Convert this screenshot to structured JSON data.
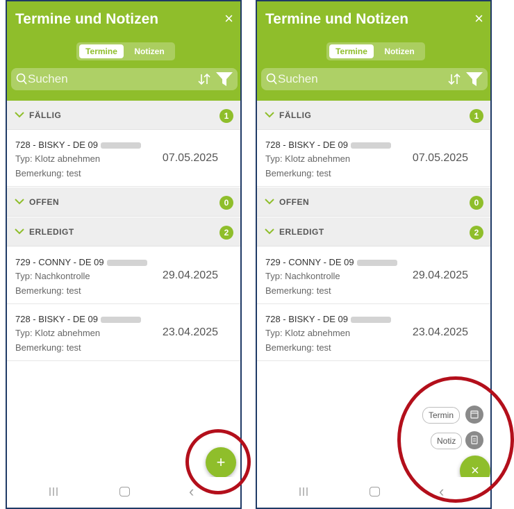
{
  "header": {
    "title": "Termine und Notizen",
    "close_symbol": "×",
    "tabs": [
      "Termine",
      "Notizen"
    ],
    "active_tab": "Termine",
    "search_placeholder": "Suchen"
  },
  "sections": [
    {
      "label": "FÄLLIG",
      "count": "1",
      "items": [
        {
          "title": "728 - BISKY - DE 09",
          "type": "Typ: Klotz abnehmen",
          "note": "Bemerkung: test",
          "date": "07.05.2025"
        }
      ]
    },
    {
      "label": "OFFEN",
      "count": "0",
      "items": []
    },
    {
      "label": "ERLEDIGT",
      "count": "2",
      "items": [
        {
          "title": "729 - CONNY - DE 09",
          "type": "Typ: Nachkontrolle",
          "note": "Bemerkung: test",
          "date": "29.04.2025"
        },
        {
          "title": "728 - BISKY - DE 09",
          "type": "Typ: Klotz abnehmen",
          "note": "Bemerkung: test",
          "date": "23.04.2025"
        }
      ]
    }
  ],
  "fab": {
    "plus_symbol": "+",
    "close_symbol": "×",
    "speed_dial": [
      "Termin",
      "Notiz"
    ]
  },
  "navbar": {
    "back_symbol": "‹"
  },
  "colors": {
    "accent": "#8fbe2b",
    "highlight": "#b30f1b",
    "frame": "#1f3a66"
  }
}
